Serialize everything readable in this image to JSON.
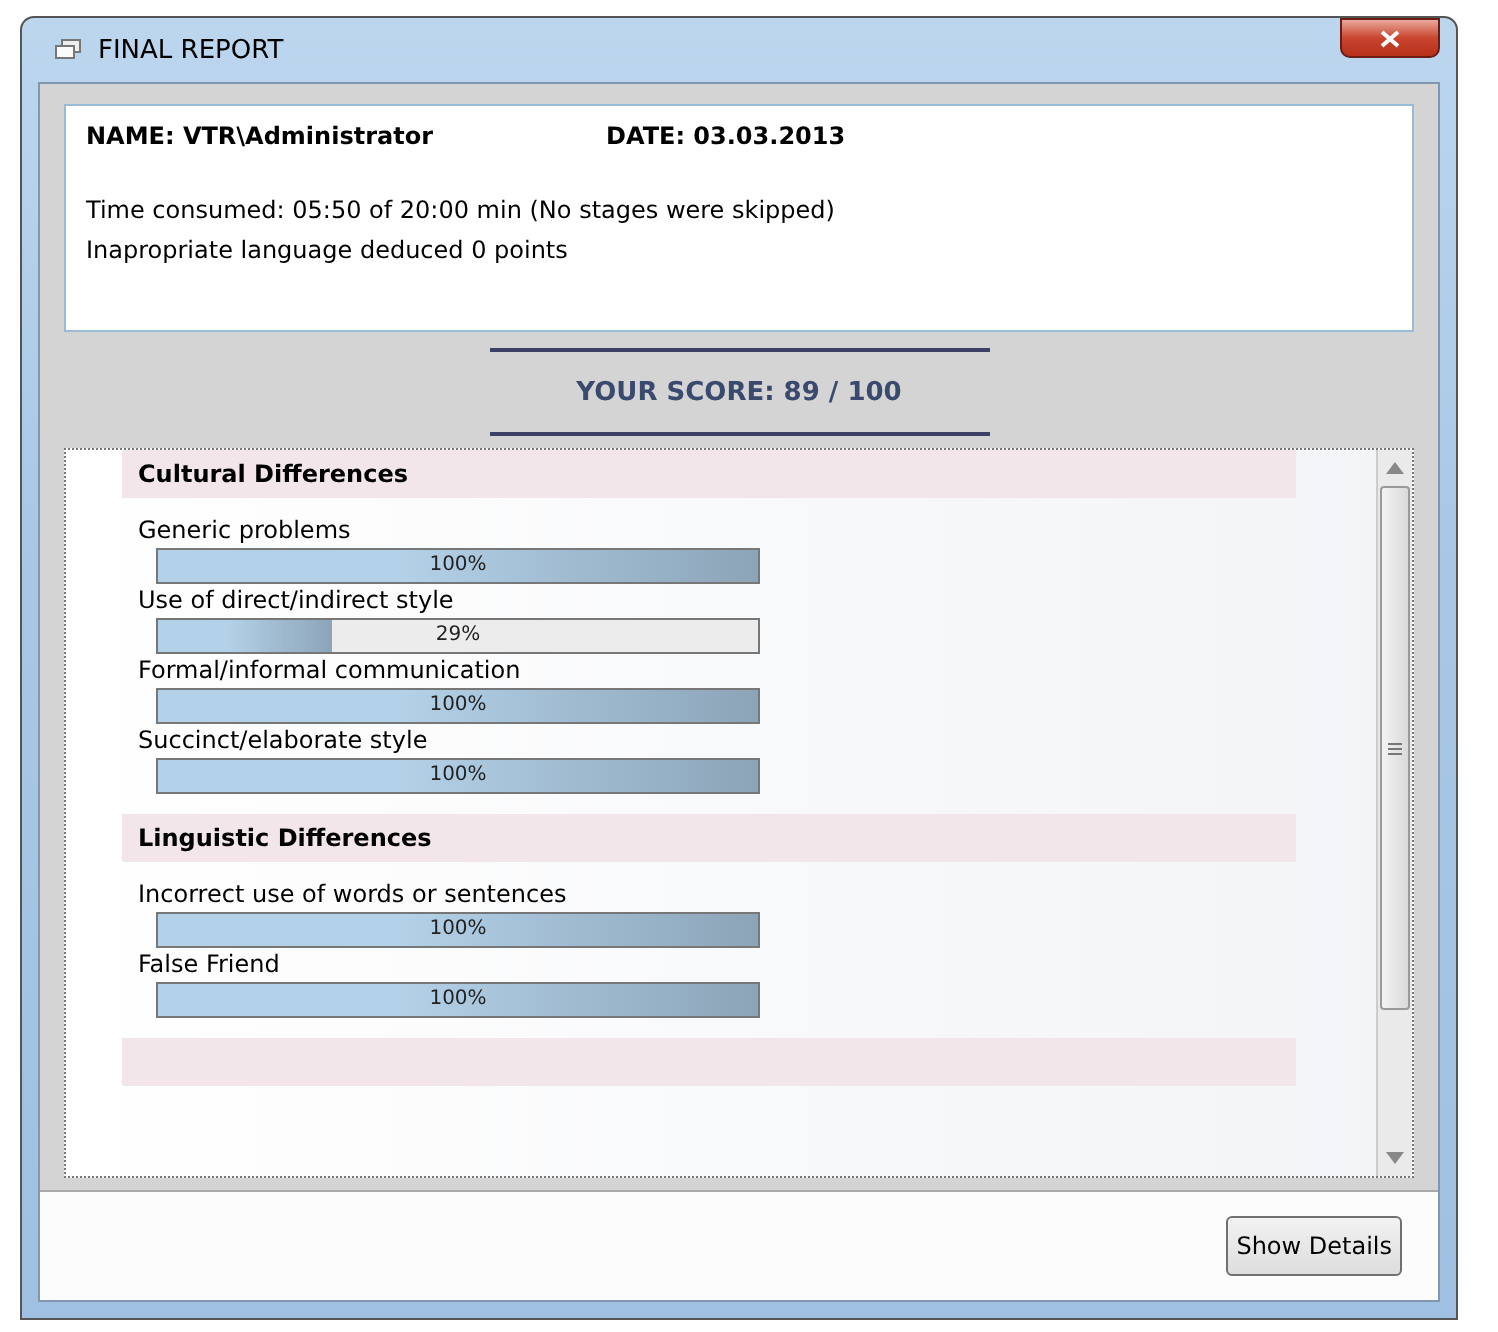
{
  "window": {
    "title": "FINAL REPORT"
  },
  "info": {
    "name": "NAME: VTR\\Administrator",
    "date": "DATE: 03.03.2013",
    "lines": [
      "Time consumed: 05:50 of 20:00 min (No stages were skipped)",
      "Inapropriate language deduced 0 points"
    ]
  },
  "score": "YOUR SCORE: 89 / 100",
  "sections": [
    {
      "title": "Cultural Differences",
      "items": [
        {
          "label": "Generic problems",
          "level": 1,
          "reading": "100%"
        },
        {
          "label": "Use of direct/indirect style",
          "level": 0.29,
          "reading": "29%"
        },
        {
          "label": "Formal/informal communication",
          "level": 1,
          "reading": "100%"
        },
        {
          "label": "Succinct/elaborate style",
          "level": 1,
          "reading": "100%"
        }
      ]
    },
    {
      "title": "Linguistic Differences",
      "items": [
        {
          "label": "Incorrect use of words or sentences",
          "level": 1,
          "reading": "100%"
        },
        {
          "label": "False Friend",
          "level": 1,
          "reading": "100%"
        }
      ]
    }
  ],
  "buttons": [
    "Show Details"
  ]
}
